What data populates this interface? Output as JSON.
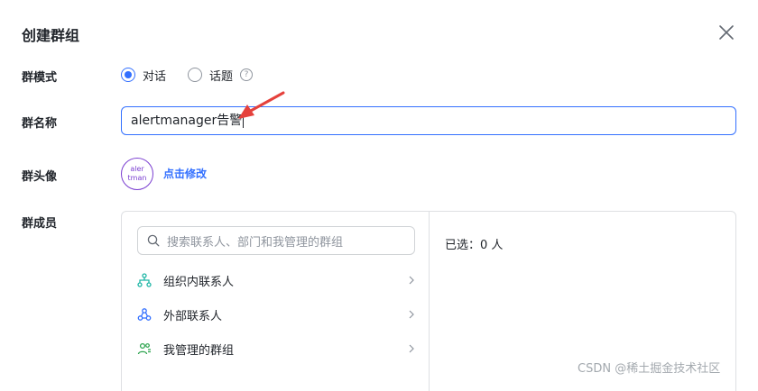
{
  "dialog": {
    "title": "创建群组"
  },
  "mode": {
    "label": "群模式",
    "options": [
      {
        "label": "对话",
        "checked": true
      },
      {
        "label": "话题",
        "checked": false
      }
    ],
    "help_symbol": "?"
  },
  "name": {
    "label": "群名称",
    "value": "alertmanager告警"
  },
  "avatar": {
    "label": "群头像",
    "text_line1": "aler",
    "text_line2": "tman",
    "edit_label": "点击修改"
  },
  "members": {
    "label": "群成员",
    "search_placeholder": "搜索联系人、部门和我管理的群组",
    "items": [
      {
        "label": "组织内联系人",
        "icon": "org-tree-icon"
      },
      {
        "label": "外部联系人",
        "icon": "external-contacts-icon"
      },
      {
        "label": "我管理的群组",
        "icon": "managed-groups-icon"
      }
    ],
    "selected_text": "已选：0 人"
  },
  "watermark": "CSDN @稀土掘金技术社区",
  "colors": {
    "accent": "#3370ff",
    "annotation_arrow": "#e5413c",
    "avatar": "#7b3fd1",
    "icon_green": "#2ea44f"
  }
}
